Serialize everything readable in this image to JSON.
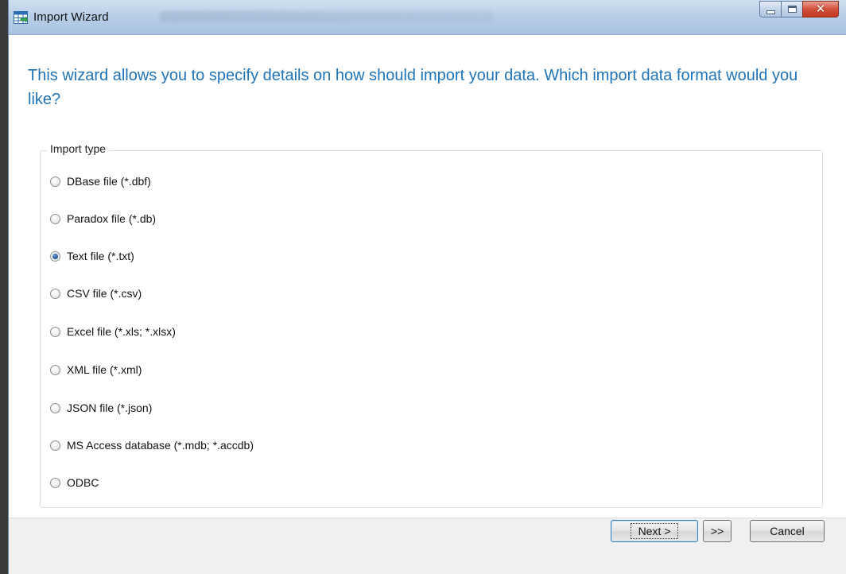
{
  "window": {
    "title": "Import Wizard"
  },
  "heading": "This wizard allows you to specify details on how should import your data. Which import data format would you like?",
  "import_type": {
    "legend": "Import type",
    "options": [
      {
        "label": "DBase file (*.dbf)",
        "checked": false
      },
      {
        "label": "Paradox file (*.db)",
        "checked": false
      },
      {
        "label": "Text file (*.txt)",
        "checked": true
      },
      {
        "label": "CSV file (*.csv)",
        "checked": false
      },
      {
        "label": "Excel file (*.xls; *.xlsx)",
        "checked": false
      },
      {
        "label": "XML file (*.xml)",
        "checked": false
      },
      {
        "label": "JSON file (*.json)",
        "checked": false
      },
      {
        "label": "MS Access database (*.mdb; *.accdb)",
        "checked": false
      },
      {
        "label": "ODBC",
        "checked": false
      }
    ]
  },
  "buttons": {
    "next": "Next >",
    "skip": ">>",
    "cancel": "Cancel"
  },
  "colors": {
    "heading": "#1f73b7",
    "titlebar": "#b9cfe8",
    "close_button": "#c23a22"
  }
}
